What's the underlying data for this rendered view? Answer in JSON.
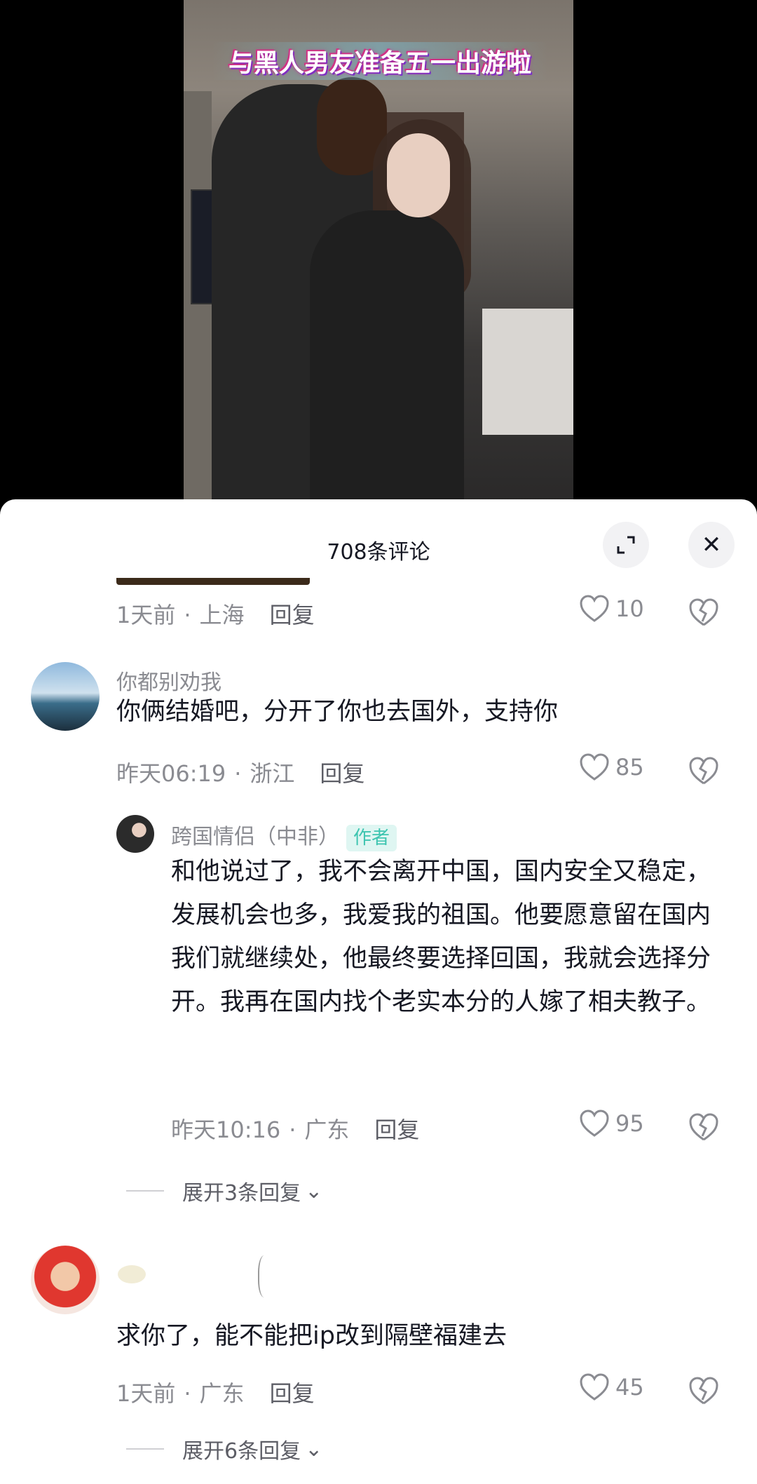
{
  "video": {
    "caption": "与黑人男友准备五一出游啦"
  },
  "sheet": {
    "title": "708条评论",
    "expand_icon": "expand-icon",
    "close_icon": "close-icon",
    "close_glyph": "✕"
  },
  "comments": [
    {
      "id": "partial",
      "time": "1天前",
      "location": "上海",
      "reply_label": "回复",
      "likes": "10"
    },
    {
      "id": "c1",
      "username": "你都别劝我",
      "text": "你俩结婚吧，分开了你也去国外，支持你",
      "time": "昨天06:19",
      "location": "浙江",
      "reply_label": "回复",
      "likes": "85"
    },
    {
      "id": "c1-reply",
      "username": "跨国情侣（中非）",
      "badge": "作者",
      "text": "和他说过了，我不会离开中国，国内安全又稳定，发展机会也多，我爱我的祖国。他要愿意留在国内我们就继续处，他最终要选择回国，我就会选择分开。我再在国内找个老实本分的人嫁了相夫教子。",
      "time": "昨天10:16",
      "location": "广东",
      "reply_label": "回复",
      "likes": "95",
      "expand_label": "展开3条回复"
    },
    {
      "id": "c2",
      "text": "求你了，能不能把ip改到隔壁福建去",
      "time": "1天前",
      "location": "广东",
      "reply_label": "回复",
      "likes": "45",
      "expand_label": "展开6条回复"
    }
  ],
  "separator_dot": "·",
  "chevron_glyph": "⌄"
}
